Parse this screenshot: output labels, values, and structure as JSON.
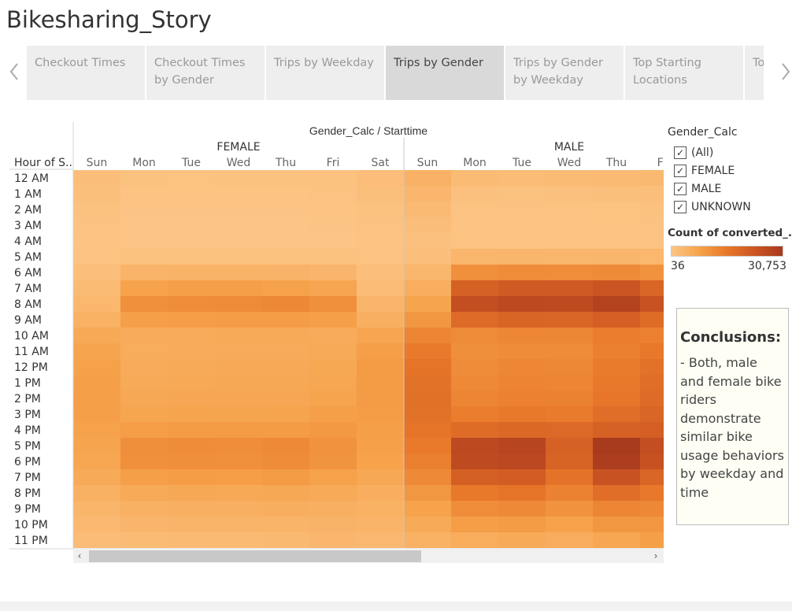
{
  "story": {
    "title": "Bikesharing_Story"
  },
  "tabs": [
    {
      "label": "Checkout Times",
      "active": false
    },
    {
      "label": "Checkout Times by Gender",
      "active": false
    },
    {
      "label": "Trips by Weekday",
      "active": false
    },
    {
      "label": "Trips by Gender",
      "active": true
    },
    {
      "label": "Trips by Gender by Weekday",
      "active": false
    },
    {
      "label": "Top Starting Locations",
      "active": false
    },
    {
      "label": "Top Loc",
      "active": false
    }
  ],
  "filter": {
    "title": "Gender_Calc",
    "items": [
      {
        "label": "(All)",
        "checked": true
      },
      {
        "label": "FEMALE",
        "checked": true
      },
      {
        "label": "MALE",
        "checked": true
      },
      {
        "label": "UNKNOWN",
        "checked": true
      }
    ]
  },
  "color_legend": {
    "title": "Count of converted_..",
    "min_label": "36",
    "max_label": "30,753",
    "colors": [
      "#fcc586",
      "#f6a24a",
      "#e8782a",
      "#cc5522",
      "#a83a1e"
    ]
  },
  "conclusions": {
    "title": "Conclusions:",
    "text": "- Both, male and female bike riders demonstrate similar bike usage behaviors by weekday and time"
  },
  "chart_data": {
    "type": "heatmap",
    "title": "Gender_Calc / Starttime",
    "row_header": "Hour of S..",
    "rows": [
      "12 AM",
      "1 AM",
      "2 AM",
      "3 AM",
      "4 AM",
      "5 AM",
      "6 AM",
      "7 AM",
      "8 AM",
      "9 AM",
      "10 AM",
      "11 AM",
      "12 PM",
      "1 PM",
      "2 PM",
      "3 PM",
      "4 PM",
      "5 PM",
      "6 PM",
      "7 PM",
      "8 PM",
      "9 PM",
      "10 PM",
      "11 PM"
    ],
    "groups": [
      {
        "name": "FEMALE",
        "columns": [
          "Sun",
          "Mon",
          "Tue",
          "Wed",
          "Thu",
          "Fri",
          "Sat"
        ],
        "values": [
          [
            1600,
            900,
            800,
            900,
            900,
            1000,
            1700
          ],
          [
            1300,
            500,
            400,
            500,
            500,
            600,
            1300
          ],
          [
            900,
            300,
            300,
            300,
            300,
            400,
            900
          ],
          [
            600,
            200,
            200,
            200,
            200,
            300,
            600
          ],
          [
            400,
            200,
            200,
            200,
            200,
            200,
            400
          ],
          [
            600,
            1000,
            1000,
            1000,
            1000,
            900,
            600
          ],
          [
            1400,
            3800,
            4000,
            4000,
            3900,
            3500,
            1400
          ],
          [
            2200,
            7500,
            8000,
            8100,
            7800,
            7000,
            2100
          ],
          [
            3200,
            11000,
            11800,
            12000,
            12500,
            11000,
            3500
          ],
          [
            4400,
            8000,
            8500,
            8600,
            8600,
            8000,
            4800
          ],
          [
            6200,
            5500,
            5700,
            5800,
            5900,
            5700,
            7000
          ],
          [
            7200,
            5300,
            5600,
            5600,
            5700,
            6000,
            8300
          ],
          [
            7800,
            5700,
            6000,
            6100,
            6100,
            6500,
            8800
          ],
          [
            8000,
            5900,
            6200,
            6300,
            6300,
            6800,
            8900
          ],
          [
            8200,
            6300,
            6600,
            6600,
            6600,
            7300,
            8900
          ],
          [
            8000,
            6900,
            7200,
            7100,
            7200,
            8000,
            8600
          ],
          [
            7800,
            8500,
            8900,
            8800,
            9000,
            9300,
            8300
          ],
          [
            7200,
            11200,
            11800,
            11600,
            12200,
            10500,
            7900
          ],
          [
            6800,
            11000,
            11400,
            11100,
            11800,
            10300,
            7600
          ],
          [
            5900,
            8200,
            8600,
            8400,
            8800,
            7800,
            6400
          ],
          [
            4600,
            6000,
            6300,
            6200,
            6400,
            6000,
            5100
          ],
          [
            3600,
            4600,
            4800,
            4800,
            5000,
            4800,
            4400
          ],
          [
            2800,
            3500,
            3700,
            3700,
            3800,
            3900,
            3700
          ],
          [
            2100,
            2300,
            2400,
            2500,
            2700,
            3300,
            3000
          ]
        ]
      },
      {
        "name": "MALE",
        "columns": [
          "Sun",
          "Mon",
          "Tue",
          "Wed",
          "Thu",
          "Fri"
        ],
        "values": [
          [
            4200,
            2300,
            2100,
            2200,
            2400,
            2700
          ],
          [
            3400,
            1200,
            1000,
            1100,
            1300,
            1500
          ],
          [
            2400,
            700,
            600,
            700,
            800,
            900
          ],
          [
            1600,
            500,
            400,
            500,
            500,
            600
          ],
          [
            1100,
            600,
            500,
            600,
            600,
            600
          ],
          [
            1500,
            3400,
            3500,
            3400,
            3500,
            3200
          ],
          [
            3300,
            11000,
            11800,
            11600,
            12000,
            10500
          ],
          [
            5100,
            20500,
            22000,
            22000,
            23500,
            19500
          ],
          [
            7200,
            25000,
            26500,
            26000,
            28500,
            24000
          ],
          [
            9800,
            18500,
            19800,
            19500,
            21000,
            18000
          ],
          [
            13000,
            12000,
            12800,
            12700,
            14500,
            14000
          ],
          [
            15000,
            11200,
            11800,
            11800,
            14000,
            15500
          ],
          [
            16200,
            11800,
            12600,
            12500,
            14800,
            16800
          ],
          [
            16800,
            12300,
            13200,
            13000,
            15200,
            17500
          ],
          [
            17000,
            13000,
            13800,
            13500,
            15800,
            18200
          ],
          [
            16800,
            14500,
            15200,
            14900,
            17500,
            19500
          ],
          [
            16200,
            18000,
            18800,
            18600,
            20500,
            21000
          ],
          [
            15000,
            26500,
            27500,
            20500,
            30753,
            25000
          ],
          [
            14200,
            26000,
            26800,
            20000,
            30000,
            24200
          ],
          [
            12200,
            20800,
            21500,
            16500,
            24000,
            19500
          ],
          [
            9800,
            15500,
            16200,
            13500,
            17500,
            15500
          ],
          [
            7600,
            11500,
            12200,
            10500,
            13000,
            12500
          ],
          [
            6000,
            8500,
            9000,
            7800,
            9800,
            10000
          ],
          [
            4500,
            5400,
            5800,
            5200,
            6800,
            8200
          ]
        ]
      }
    ],
    "color_range": [
      36,
      30753
    ]
  }
}
